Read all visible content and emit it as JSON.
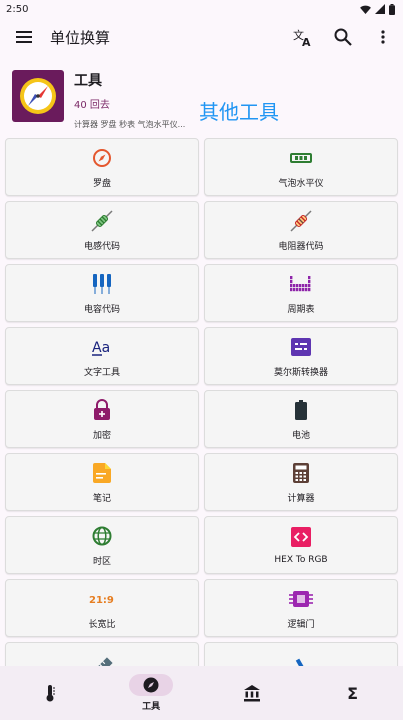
{
  "status": {
    "time": "2:50"
  },
  "appbar": {
    "title": "单位换算"
  },
  "header": {
    "title": "工具",
    "subtitle": "40 回去",
    "tools_list": "计算器 罗盘 秒表 气泡水平仪...",
    "overlay_text": "其他工具"
  },
  "tools": [
    {
      "label": "罗盘",
      "icon": "compass-icon",
      "color": "#e4572e"
    },
    {
      "label": "气泡水平仪",
      "icon": "bubble-level-icon",
      "color": "#2e7d32"
    },
    {
      "label": "电感代码",
      "icon": "inductor-icon",
      "color": "#2e7d32"
    },
    {
      "label": "电阻器代码",
      "icon": "resistor-icon",
      "color": "#c62828"
    },
    {
      "label": "电容代码",
      "icon": "capacitor-icon",
      "color": "#1565c0"
    },
    {
      "label": "周期表",
      "icon": "periodic-table-icon",
      "color": "#8e24aa"
    },
    {
      "label": "文字工具",
      "icon": "text-tool-icon",
      "color": "#1a237e"
    },
    {
      "label": "莫尔斯转换器",
      "icon": "morse-icon",
      "color": "#5e35b1"
    },
    {
      "label": "加密",
      "icon": "lock-icon",
      "color": "#8e1b6a"
    },
    {
      "label": "电池",
      "icon": "battery-icon",
      "color": "#263238"
    },
    {
      "label": "笔记",
      "icon": "note-icon",
      "color": "#f9a825"
    },
    {
      "label": "计算器",
      "icon": "calculator-icon",
      "color": "#5d4037"
    },
    {
      "label": "时区",
      "icon": "globe-icon",
      "color": "#2e7d32"
    },
    {
      "label": "HEX To RGB",
      "icon": "code-icon",
      "color": "#e91e63"
    },
    {
      "label": "长宽比",
      "icon": "aspect-ratio-icon",
      "color": "#e67e22",
      "text": "21:9"
    },
    {
      "label": "逻辑门",
      "icon": "chip-icon",
      "color": "#9c27b0"
    },
    {
      "label": "",
      "icon": "ruler-icon",
      "color": "#546e7a"
    },
    {
      "label": "",
      "icon": "microscope-icon",
      "color": "#1565c0"
    }
  ],
  "nav": [
    {
      "label": "",
      "icon": "thermometer-icon"
    },
    {
      "label": "工具",
      "icon": "compass-icon"
    },
    {
      "label": "",
      "icon": "bank-icon"
    },
    {
      "label": "",
      "icon": "sigma-icon",
      "glyph": "Σ"
    }
  ]
}
